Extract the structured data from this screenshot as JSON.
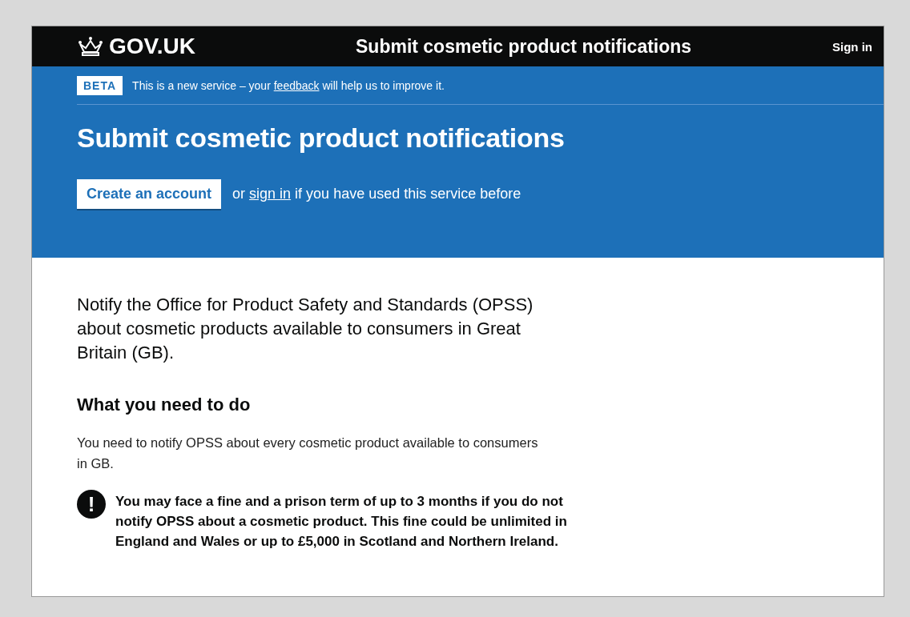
{
  "header": {
    "logo": "GOV.UK",
    "service_name": "Submit cosmetic product notifications",
    "sign_in": "Sign in"
  },
  "phase_banner": {
    "tag": "BETA",
    "text_before": "This is a new service – your",
    "link": "feedback",
    "text_after": "will help us to improve it."
  },
  "hero": {
    "title": "Submit cosmetic product notifications",
    "button": "Create an account",
    "text_before": "or",
    "link": "sign in",
    "text_after": "if you have used this service before"
  },
  "lead": "Notify the Office for Product Safety and Standards (OPSS) about cosmetic products available to consumers in Great Britain (GB).",
  "heading": "What you need to do",
  "body": "You need to notify OPSS about every cosmetic product available to consumers in GB.",
  "warning": {
    "icon": "!",
    "text": "You may face a fine and a prison term of up to 3 months if you do not notify OPSS about a cosmetic product. This fine could be unlimited in England and Wales or up to £5,000 in Scotland and Northern Ireland."
  }
}
